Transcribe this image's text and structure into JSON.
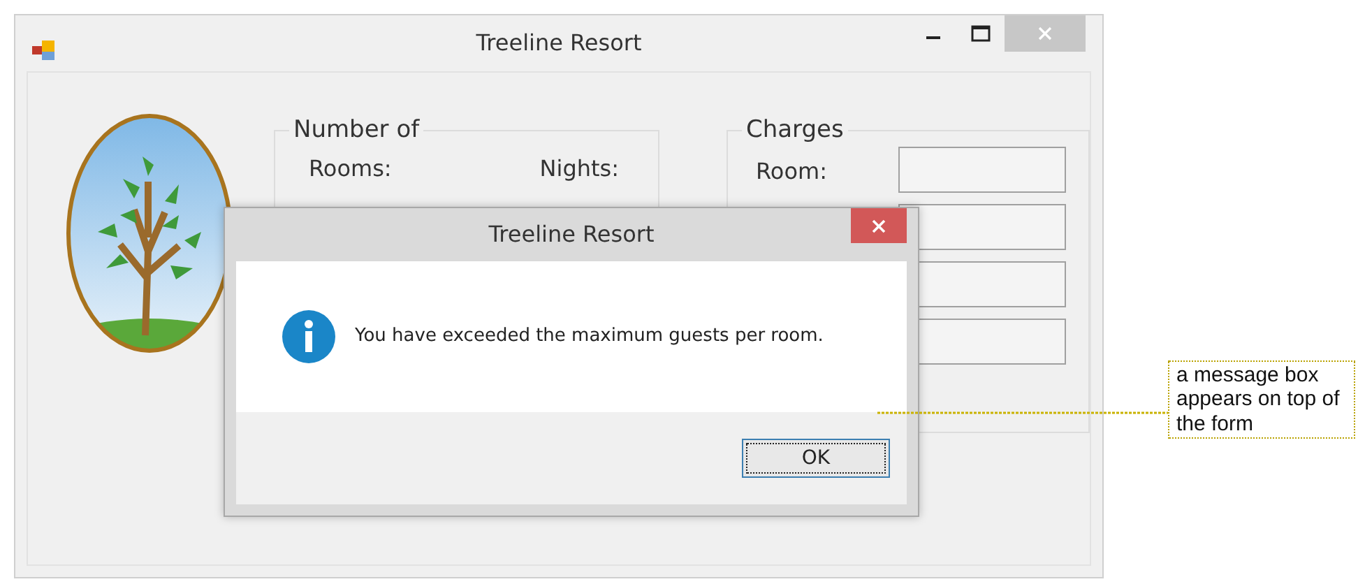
{
  "window": {
    "title": "Treeline Resort"
  },
  "number_of_group": {
    "title": "Number of",
    "labels": [
      "Rooms:",
      "Nights:"
    ]
  },
  "charges_group": {
    "title": "Charges",
    "labels": [
      "Room:"
    ]
  },
  "message_box": {
    "title": "Treeline Resort",
    "message": "You have exceeded the maximum guests per room.",
    "buttons": [
      {
        "label": "OK",
        "focused": true
      }
    ]
  },
  "callout": {
    "text": "a message box appears on top of the form"
  }
}
